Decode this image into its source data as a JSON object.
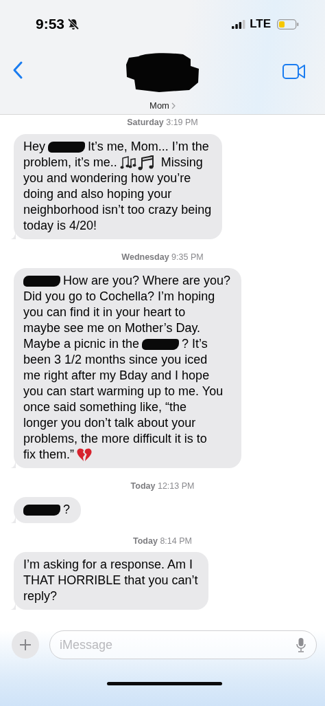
{
  "status_bar": {
    "time": "9:53",
    "network": "LTE"
  },
  "header": {
    "contact_name": "Mom"
  },
  "thread": [
    {
      "kind": "timestamp",
      "text": "**Saturday** 3:19 PM"
    },
    {
      "kind": "message",
      "lines": [
        [
          {
            "kind": "text",
            "text": "Hey"
          },
          {
            "kind": "redaction"
          },
          {
            "kind": "text",
            "text": "It’s me, Mom... I’m the"
          }
        ],
        [
          {
            "kind": "text",
            "text": "problem, it’s me.."
          },
          {
            "kind": "notes"
          },
          {
            "kind": "text",
            "text": "Missing"
          }
        ],
        [
          {
            "kind": "text",
            "text": "you and wondering how you’re"
          }
        ],
        [
          {
            "kind": "text",
            "text": "doing and also hoping your"
          }
        ],
        [
          {
            "kind": "text",
            "text": "neighborhood isn’t too crazy being"
          }
        ],
        [
          {
            "kind": "text",
            "text": "today is 4/20!"
          }
        ]
      ]
    },
    {
      "kind": "timestamp",
      "text": "**Wednesday** 9:35 PM"
    },
    {
      "kind": "message",
      "lines": [
        [
          {
            "kind": "redaction"
          },
          {
            "kind": "text",
            "text": "How are you? Where are you?"
          }
        ],
        [
          {
            "kind": "text",
            "text": "Did you go to Cochella? I’m hoping"
          }
        ],
        [
          {
            "kind": "text",
            "text": "you can find it in your heart to"
          }
        ],
        [
          {
            "kind": "text",
            "text": "maybe see me on Mother’s Day."
          }
        ],
        [
          {
            "kind": "text",
            "text": "Maybe a picnic in the"
          },
          {
            "kind": "redaction"
          },
          {
            "kind": "text",
            "text": "? It’s"
          }
        ],
        [
          {
            "kind": "text",
            "text": "been 3 1/2 months since you iced"
          }
        ],
        [
          {
            "kind": "text",
            "text": "me right after my Bday and I hope"
          }
        ],
        [
          {
            "kind": "text",
            "text": "you can start warming up to me. You"
          }
        ],
        [
          {
            "kind": "text",
            "text": "once said something like, “the"
          }
        ],
        [
          {
            "kind": "text",
            "text": "longer you don’t talk about your"
          }
        ],
        [
          {
            "kind": "text",
            "text": "problems, the more difficult it is to"
          }
        ],
        [
          {
            "kind": "text",
            "text": "fix them.”"
          },
          {
            "kind": "heartbreak"
          }
        ]
      ]
    },
    {
      "kind": "timestamp",
      "text": "**Today** 12:13 PM"
    },
    {
      "kind": "message",
      "lines": [
        [
          {
            "kind": "redaction"
          },
          {
            "kind": "text",
            "text": "?"
          }
        ]
      ]
    },
    {
      "kind": "timestamp",
      "text": "**Today** 8:14 PM"
    },
    {
      "kind": "message",
      "lines": [
        [
          {
            "kind": "text",
            "text": "I’m asking for a response. Am I"
          }
        ],
        [
          {
            "kind": "text",
            "text": "THAT HORRIBLE that you can’t"
          }
        ],
        [
          {
            "kind": "text",
            "text": "reply?"
          }
        ]
      ]
    }
  ],
  "composer": {
    "placeholder": "iMessage"
  }
}
